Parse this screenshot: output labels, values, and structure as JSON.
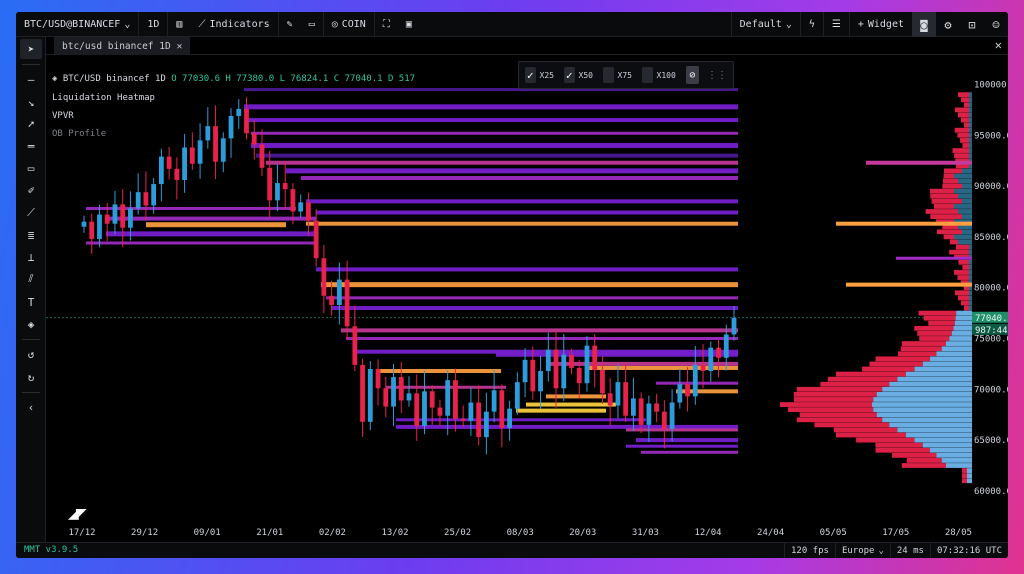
{
  "topbar": {
    "symbol": "BTC/USD@BINANCEF",
    "timeframe": "1D",
    "indicators_label": "Indicators",
    "coin_label": "COIN",
    "layout_label": "Default",
    "widget_label": "Widget"
  },
  "tab": {
    "title": "btc/usd binancef 1D"
  },
  "legend": {
    "symbol_line": "BTC/USD binancef 1D",
    "ohlc": "O 77030.6  H 77380.0  L 76824.1  C 77040.1  D 517",
    "items": [
      "Liquidation Heatmap",
      "VPVR",
      "OB Profile"
    ]
  },
  "zoom_panel": {
    "options": [
      {
        "label": "X25",
        "checked": true
      },
      {
        "label": "X50",
        "checked": true
      },
      {
        "label": "X75",
        "checked": false
      },
      {
        "label": "X100",
        "checked": false
      }
    ]
  },
  "price_axis": [
    "100000.0",
    "95000.0",
    "90000.0",
    "85000.0",
    "80000.0",
    "75000.0",
    "70000.0",
    "65000.0",
    "60000.0"
  ],
  "last_price": {
    "value": "77040.1",
    "countdown": "987:44"
  },
  "time_axis": [
    "17/12",
    "29/12",
    "09/01",
    "21/01",
    "02/02",
    "13/02",
    "25/02",
    "08/03",
    "20/03",
    "31/03",
    "12/04",
    "24/04",
    "05/05",
    "17/05",
    "28/05"
  ],
  "status": {
    "version": "MMT v3.9.5",
    "fps": "120 fps",
    "region": "Europe",
    "latency": "24 ms",
    "clock": "07:32:16 UTC"
  },
  "colors": {
    "up": "#2d9cdb",
    "down": "#e8224a",
    "accent": "#2ec4a0",
    "band_hot": "#ff9f40",
    "band_cool": "#7a1fd6"
  }
}
